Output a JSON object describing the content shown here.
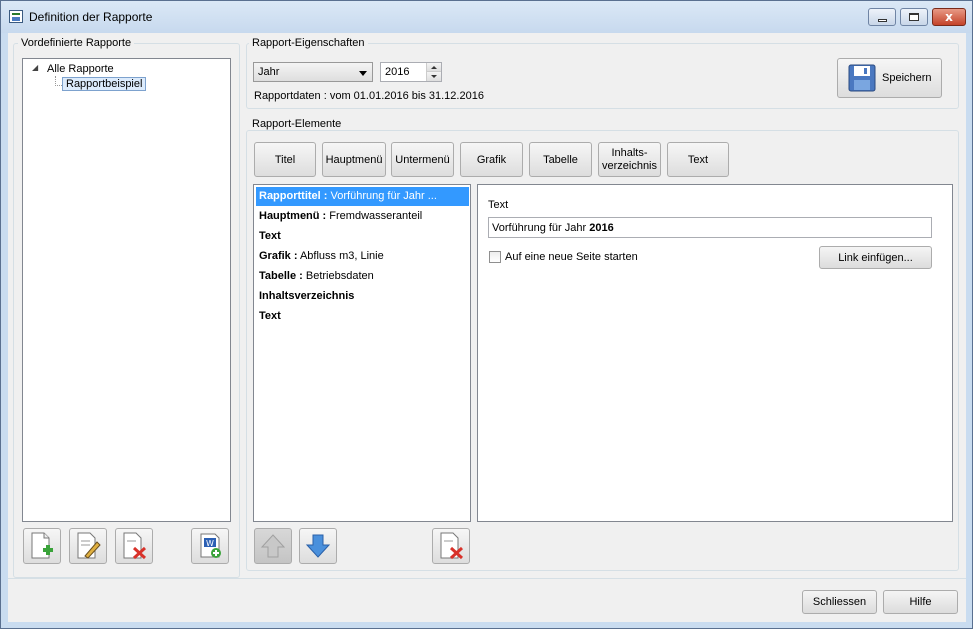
{
  "window": {
    "title": "Definition der Rapporte",
    "minimize_label": "",
    "maximize_label": "",
    "close_label": "x"
  },
  "left": {
    "group_label": "Vordefinierte Rapporte",
    "tree": {
      "root": "Alle Rapporte",
      "child": "Rapportbeispiel"
    }
  },
  "props": {
    "group_label": "Rapport-Eigenschaften",
    "period_select": "Jahr",
    "year_value": "2016",
    "date_range": "Rapportdaten : vom 01.01.2016 bis 31.12.2016",
    "save_label": "Speichern"
  },
  "elements": {
    "group_label": "Rapport-Elemente",
    "buttons": [
      "Titel",
      "Hauptmenü",
      "Untermenü",
      "Grafik",
      "Tabelle",
      "Inhalts-\nverzeichnis",
      "Text"
    ],
    "list": [
      {
        "key": "Rapporttitel :",
        "value": "Vorführung für Jahr ..."
      },
      {
        "key": "Hauptmenü :",
        "value": "Fremdwasseranteil"
      },
      {
        "key": "Text",
        "value": ""
      },
      {
        "key": "Grafik :",
        "value": "Abfluss m3, Linie"
      },
      {
        "key": "Tabelle :",
        "value": "Betriebsdaten"
      },
      {
        "key": "Inhaltsverzeichnis",
        "value": ""
      },
      {
        "key": "Text",
        "value": ""
      }
    ]
  },
  "detail": {
    "label": "Text",
    "input_prefix": "Vorführung für Jahr",
    "input_bold": "2016",
    "checkbox_label": "Auf eine neue Seite starten",
    "link_button": "Link einfügen..."
  },
  "footer": {
    "close_label": "Schliessen",
    "help_label": "Hilfe"
  },
  "colors": {
    "selection": "#3399ff",
    "window_frame": "#c9dcf0",
    "close_button": "#c4432a"
  }
}
